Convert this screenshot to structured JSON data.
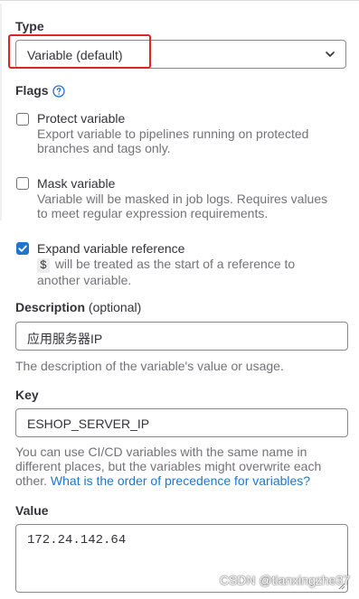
{
  "type_section": {
    "label": "Type",
    "selected": "Variable (default)"
  },
  "flags_section": {
    "label": "Flags",
    "help_icon": "question-circle-icon",
    "protect": {
      "title": "Protect variable",
      "desc_line1": "Export variable to pipelines running on protected",
      "desc_line2": "branches and tags only.",
      "checked": false
    },
    "mask": {
      "title": "Mask variable",
      "desc_line1": "Variable will be masked in job logs. Requires values",
      "desc_line2": "to meet regular expression requirements.",
      "checked": false
    },
    "expand": {
      "title": "Expand variable reference",
      "code": "$",
      "desc_line1_rest": "will be treated as the start of a reference to",
      "desc_line2": "another variable.",
      "checked": true
    }
  },
  "description_section": {
    "label": "Description",
    "optional": "(optional)",
    "value": "应用服务器IP",
    "hint": "The description of the variable's value or usage."
  },
  "key_section": {
    "label": "Key",
    "value": "ESHOP_SERVER_IP",
    "hint_line1": "You can use CI/CD variables with the same name in",
    "hint_line2": "different places, but the variables might overwrite each",
    "hint_line3_prefix": "other.",
    "hint_link": "What is the order of precedence for variables?"
  },
  "value_section": {
    "label": "Value",
    "value": "172.24.142.64"
  },
  "watermark": "CSDN @tianxingzhe37",
  "colors": {
    "accent": "#1f75cb",
    "highlight_box": "#e02424",
    "text": "#333238",
    "muted": "#737278"
  }
}
